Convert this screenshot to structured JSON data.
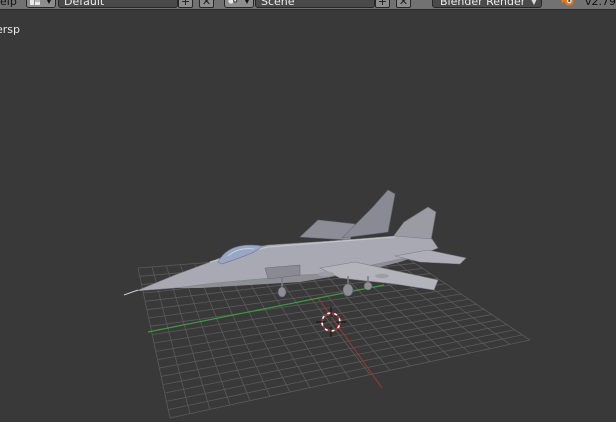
{
  "header": {
    "help_menu": "elp",
    "layout_name": "Default",
    "scene_name": "Scene",
    "render_engine": "Blender Render",
    "version": "v2.79"
  },
  "viewport": {
    "view_label": "ersp"
  },
  "colors": {
    "viewport_bg": "#393939",
    "grid_line": "#5a5a5a",
    "x_axis": "#8a3a3a",
    "y_axis": "#3f9a3f",
    "cursor_red": "#cc2a2a",
    "model_gray": "#a8a8b2",
    "header_bg": "#727272",
    "blender_logo": "#e87d0d"
  },
  "icons": [
    "layout-screen-icon",
    "scene-icon",
    "add-icon",
    "close-icon",
    "dropdown-arrow-icon",
    "blender-logo-icon",
    "3d-cursor-icon"
  ]
}
